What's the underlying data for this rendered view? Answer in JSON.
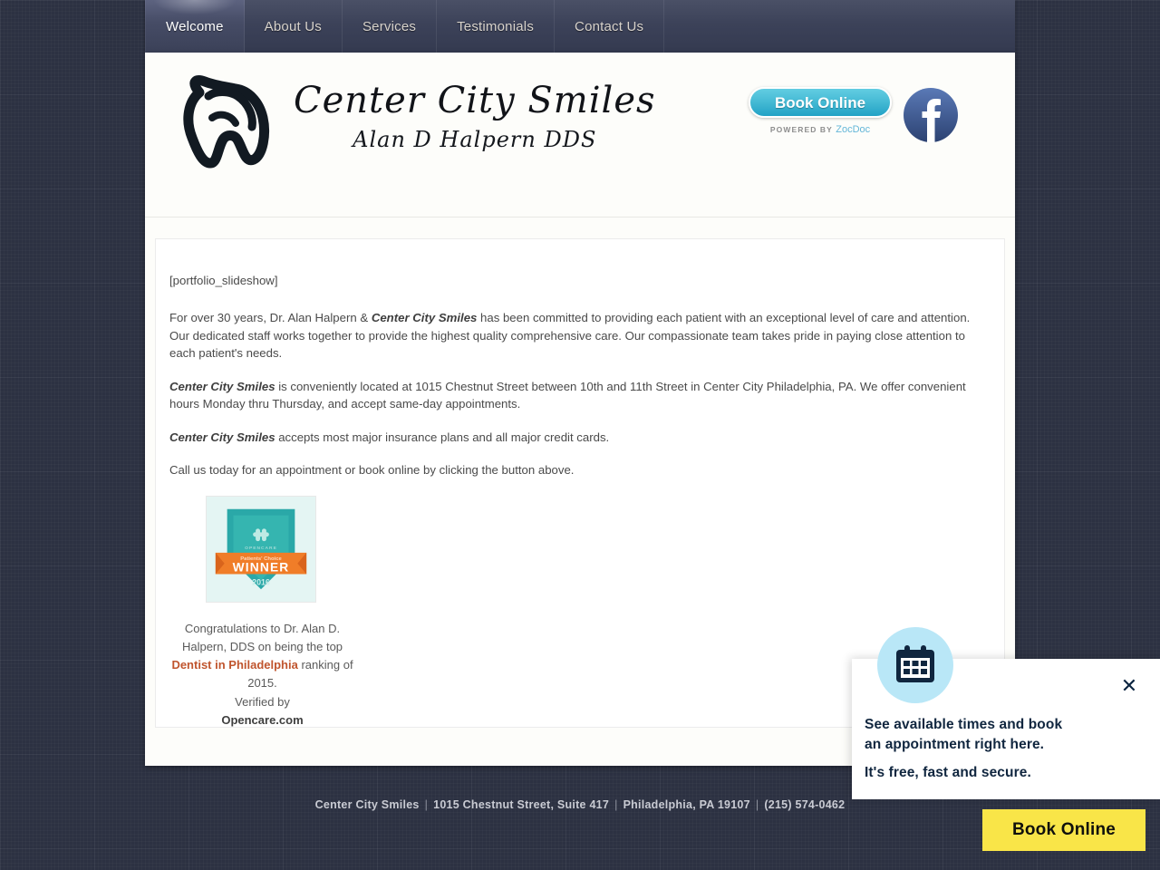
{
  "nav": {
    "items": [
      {
        "label": "Welcome",
        "active": true
      },
      {
        "label": "About Us",
        "active": false
      },
      {
        "label": "Services",
        "active": false
      },
      {
        "label": "Testimonials",
        "active": false
      },
      {
        "label": "Contact Us",
        "active": false
      }
    ]
  },
  "logo": {
    "title": "Center City Smiles",
    "subtitle": "Alan D Halpern DDS",
    "mark": "tooth-icon"
  },
  "header": {
    "book_online_label": "Book Online",
    "powered_prefix": "POWERED BY",
    "powered_brand": "ZocDoc",
    "facebook_icon": "facebook-icon"
  },
  "content": {
    "shortcode": "[portfolio_slideshow]",
    "paragraphs": [
      {
        "pre": "For over 30 years, Dr. Alan Halpern & ",
        "em": "Center City Smiles",
        "post": " has been committed to providing each patient with an exceptional level of care and attention. Our dedicated staff works together to provide the highest quality comprehensive care. Our compassionate  team takes pride in paying close attention to each patient's needs."
      },
      {
        "pre": "",
        "em": "Center City Smiles",
        "post": " is conveniently located at 1015 Chestnut Street between 10th and 11th Street in Center City Philadelphia, PA. We offer convenient hours Monday thru Thursday, and accept same-day appointments."
      },
      {
        "pre": "",
        "em": "Center City Smiles",
        "post": " accepts most major insurance plans and all major credit cards."
      },
      {
        "pre": "Call us today for an appointment or book online by clicking the button above.",
        "em": "",
        "post": ""
      }
    ],
    "award": {
      "badge_alt": "opencare-patients-choice-winner-badge",
      "badge_brand": "OPENCARE",
      "badge_ribbon_small": "Patients' Choice",
      "badge_ribbon": "WINNER",
      "badge_year": "2016",
      "caption_line1": "Congratulations to Dr. Alan D.",
      "caption_line2": "Halpern, DDS on being the  top",
      "caption_link": "Dentist in Philadelphia",
      "caption_line3": " ranking of 2015.",
      "verified_by": "Verified by",
      "verifier": "Opencare.com"
    }
  },
  "footer": {
    "business": "Center City Smiles",
    "address": "1015 Chestnut Street, Suite 417",
    "city_state_zip": "Philadelphia, PA 19107",
    "phone": "(215) 574-0462",
    "separator": "|"
  },
  "zocdoc_widget": {
    "calendar_icon": "calendar-icon",
    "close_icon": "close-icon",
    "line1": "See available times and book",
    "line2": "an appointment right here.",
    "line3": "It's free, fast and secure.",
    "book_button_label": "Book Online"
  },
  "colors": {
    "page_background": "#2c3142",
    "nav_background": "#3c4259",
    "teal_button": "#45bad4",
    "yellow_button": "#f9e548",
    "link_orange": "#c0552e",
    "zocdoc_navy": "#10263f",
    "badge_teal": "#2aa8a8",
    "badge_orange": "#f07d28",
    "facebook_blue": "#3b5998"
  }
}
